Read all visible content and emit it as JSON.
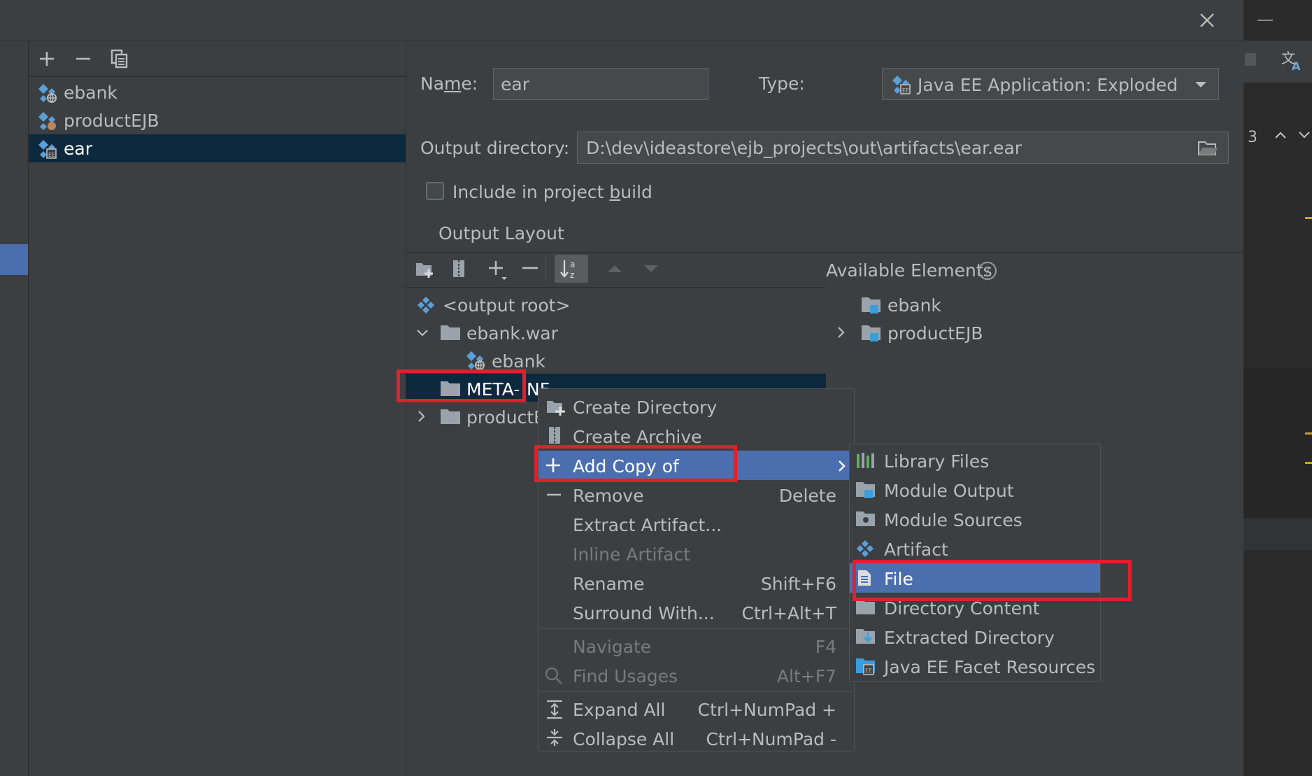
{
  "dialog": {
    "close_icon": "close-icon"
  },
  "artifact_list": {
    "toolbar": [
      "add-icon",
      "remove-icon",
      "copy-icon"
    ],
    "items": [
      {
        "label": "ebank",
        "icon": "web-artifact-icon"
      },
      {
        "label": "productEJB",
        "icon": "ejb-artifact-icon"
      },
      {
        "label": "ear",
        "icon": "ear-artifact-icon",
        "selected": true
      }
    ]
  },
  "form": {
    "name_label": "Name:",
    "name_value": "ear",
    "type_label": "Type:",
    "type_value": "Java EE Application: Exploded",
    "output_dir_label": "Output directory:",
    "output_dir_value": "D:\\dev\\ideastore\\ejb_projects\\out\\artifacts\\ear.ear",
    "include_label": "Include in project build",
    "include_checked": false,
    "output_layout_tab": "Output Layout"
  },
  "layout_tree": {
    "items": [
      {
        "label": "<output root>",
        "level": 0
      },
      {
        "label": "ebank.war",
        "level": 0,
        "expanded": true
      },
      {
        "label": "ebank",
        "level": 1
      },
      {
        "label": "META-INF",
        "level": 0,
        "selected": true
      },
      {
        "label": "productEJB",
        "level": 0,
        "collapsed": true
      }
    ],
    "visible_labels": {
      "meta": "META-",
      "meta_tail": "NF",
      "product": "productE"
    }
  },
  "available": {
    "title": "Available Elements",
    "items": [
      {
        "label": "ebank"
      },
      {
        "label": "productEJB",
        "collapsed": true
      }
    ]
  },
  "context_menu": {
    "items": [
      {
        "label": "Create Directory",
        "shortcut": "",
        "icon": "create-directory-icon"
      },
      {
        "label": "Create Archive",
        "shortcut": "",
        "icon": "create-archive-icon"
      },
      {
        "label": "Add Copy of",
        "shortcut": "",
        "icon": "add-icon",
        "submenu": true,
        "highlighted": true
      },
      {
        "label": "Remove",
        "shortcut": "Delete",
        "icon": "remove-icon"
      },
      {
        "label": "Extract Artifact...",
        "shortcut": ""
      },
      {
        "label": "Inline Artifact",
        "shortcut": "",
        "disabled": true
      },
      {
        "label": "Rename",
        "shortcut": "Shift+F6"
      },
      {
        "label": "Surround With...",
        "shortcut": "Ctrl+Alt+T"
      },
      {
        "label": "Navigate",
        "shortcut": "F4",
        "disabled": true
      },
      {
        "label": "Find Usages",
        "shortcut": "Alt+F7",
        "disabled": true,
        "icon": "search-icon"
      },
      {
        "label": "Expand All",
        "shortcut": "Ctrl+NumPad +",
        "icon": "expand-all-icon"
      },
      {
        "label": "Collapse All",
        "shortcut": "Ctrl+NumPad -",
        "icon": "collapse-all-icon"
      }
    ]
  },
  "submenu": {
    "items": [
      {
        "label": "Library Files",
        "icon": "library-icon"
      },
      {
        "label": "Module Output",
        "icon": "module-output-icon"
      },
      {
        "label": "Module Sources",
        "icon": "module-sources-icon"
      },
      {
        "label": "Artifact",
        "icon": "artifact-icon"
      },
      {
        "label": "File",
        "icon": "file-icon",
        "highlighted": true
      },
      {
        "label": "Directory Content",
        "icon": "folder-icon"
      },
      {
        "label": "Extracted Directory",
        "icon": "extracted-directory-icon"
      },
      {
        "label": "Java EE Facet Resources",
        "icon": "facet-resources-icon"
      }
    ]
  },
  "background": {
    "page_count": "3"
  },
  "colors": {
    "accent": "#4b6eaf",
    "selection": "#0d293e",
    "highlight_box": "#e0202a",
    "background": "#3c3f41"
  }
}
